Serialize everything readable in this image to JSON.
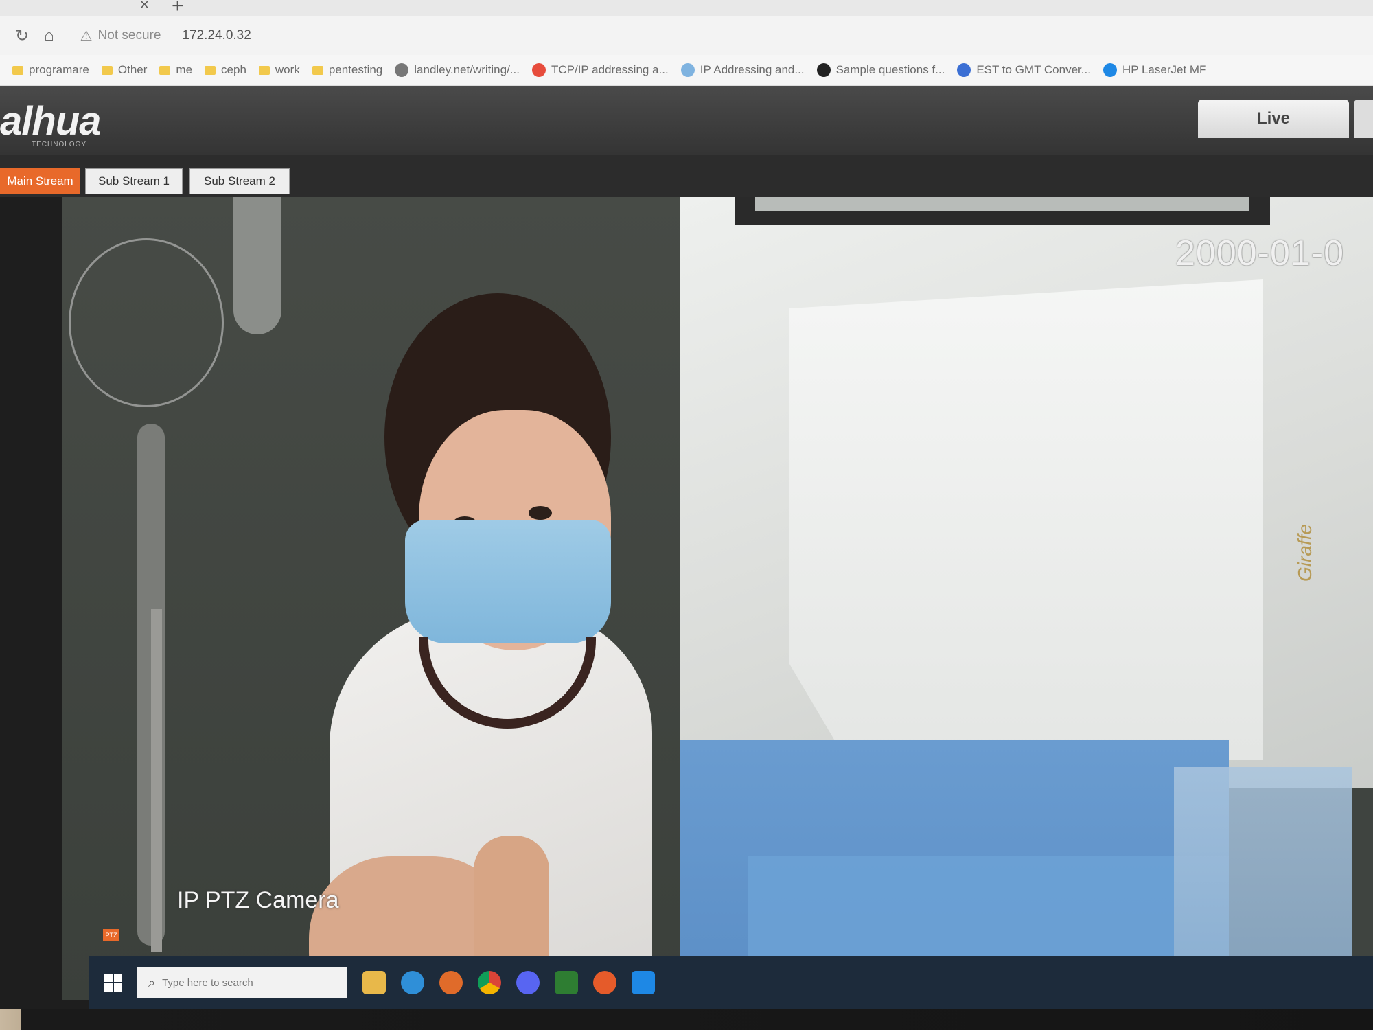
{
  "browser": {
    "tab_close": "×",
    "tab_new": "+",
    "security_text": "Not secure",
    "url": "172.24.0.32",
    "bookmarks": [
      {
        "label": "programare",
        "kind": "folder"
      },
      {
        "label": "Other",
        "kind": "folder"
      },
      {
        "label": "me",
        "kind": "folder"
      },
      {
        "label": "ceph",
        "kind": "folder"
      },
      {
        "label": "work",
        "kind": "folder"
      },
      {
        "label": "pentesting",
        "kind": "folder"
      },
      {
        "label": "landley.net/writing/...",
        "kind": "globe-icon"
      },
      {
        "label": "TCP/IP addressing a...",
        "kind": "microsoft-icon"
      },
      {
        "label": "IP Addressing and...",
        "kind": "network-icon"
      },
      {
        "label": "Sample questions f...",
        "kind": "github-icon"
      },
      {
        "label": "EST to GMT Conver...",
        "kind": "clock-icon"
      },
      {
        "label": "HP LaserJet MF",
        "kind": "hp-icon"
      }
    ]
  },
  "app": {
    "logo": "alhua",
    "logo_sub": "TECHNOLOGY",
    "live_tab": "Live",
    "streams": {
      "main": "Main Stream",
      "sub1": "Sub Stream 1",
      "sub2": "Sub Stream 2"
    }
  },
  "video": {
    "timestamp": "2000-01-0",
    "camera_label": "IP PTZ Camera",
    "warmer_brand": "Giraffe",
    "ptz_button": "PTZ"
  },
  "taskbar": {
    "search_placeholder": "Type here to search"
  },
  "colors": {
    "accent_orange": "#e8692a",
    "header_dark": "#343434",
    "taskbar": "#1d2b3b"
  }
}
